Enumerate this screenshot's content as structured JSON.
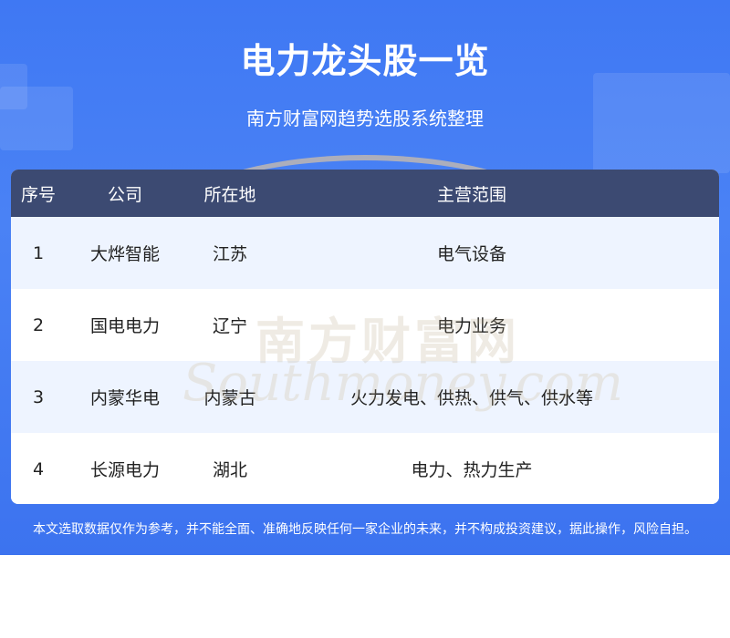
{
  "header": {
    "title": "电力龙头股一览",
    "subtitle": "南方财富网趋势选股系统整理"
  },
  "table": {
    "columns": [
      "序号",
      "公司",
      "所在地",
      "主营范围"
    ],
    "rows": [
      {
        "no": "1",
        "company": "大烨智能",
        "location": "江苏",
        "business": "电气设备"
      },
      {
        "no": "2",
        "company": "国电电力",
        "location": "辽宁",
        "business": "电力业务"
      },
      {
        "no": "3",
        "company": "内蒙华电",
        "location": "内蒙古",
        "business": "火力发电、供热、供气、供水等"
      },
      {
        "no": "4",
        "company": "长源电力",
        "location": "湖北",
        "business": "电力、热力生产"
      }
    ]
  },
  "watermark": {
    "cn": "南方财富网",
    "en": "Southmoney.com"
  },
  "footer": {
    "disclaimer": "本文选取数据仅作为参考，并不能全面、准确地反映任何一家企业的未来，并不构成投资建议，据此操作，风险自担。"
  },
  "colors": {
    "banner": "#4a82f5",
    "table_header": "#3c4a72",
    "row_alt": "#eef4ff"
  }
}
